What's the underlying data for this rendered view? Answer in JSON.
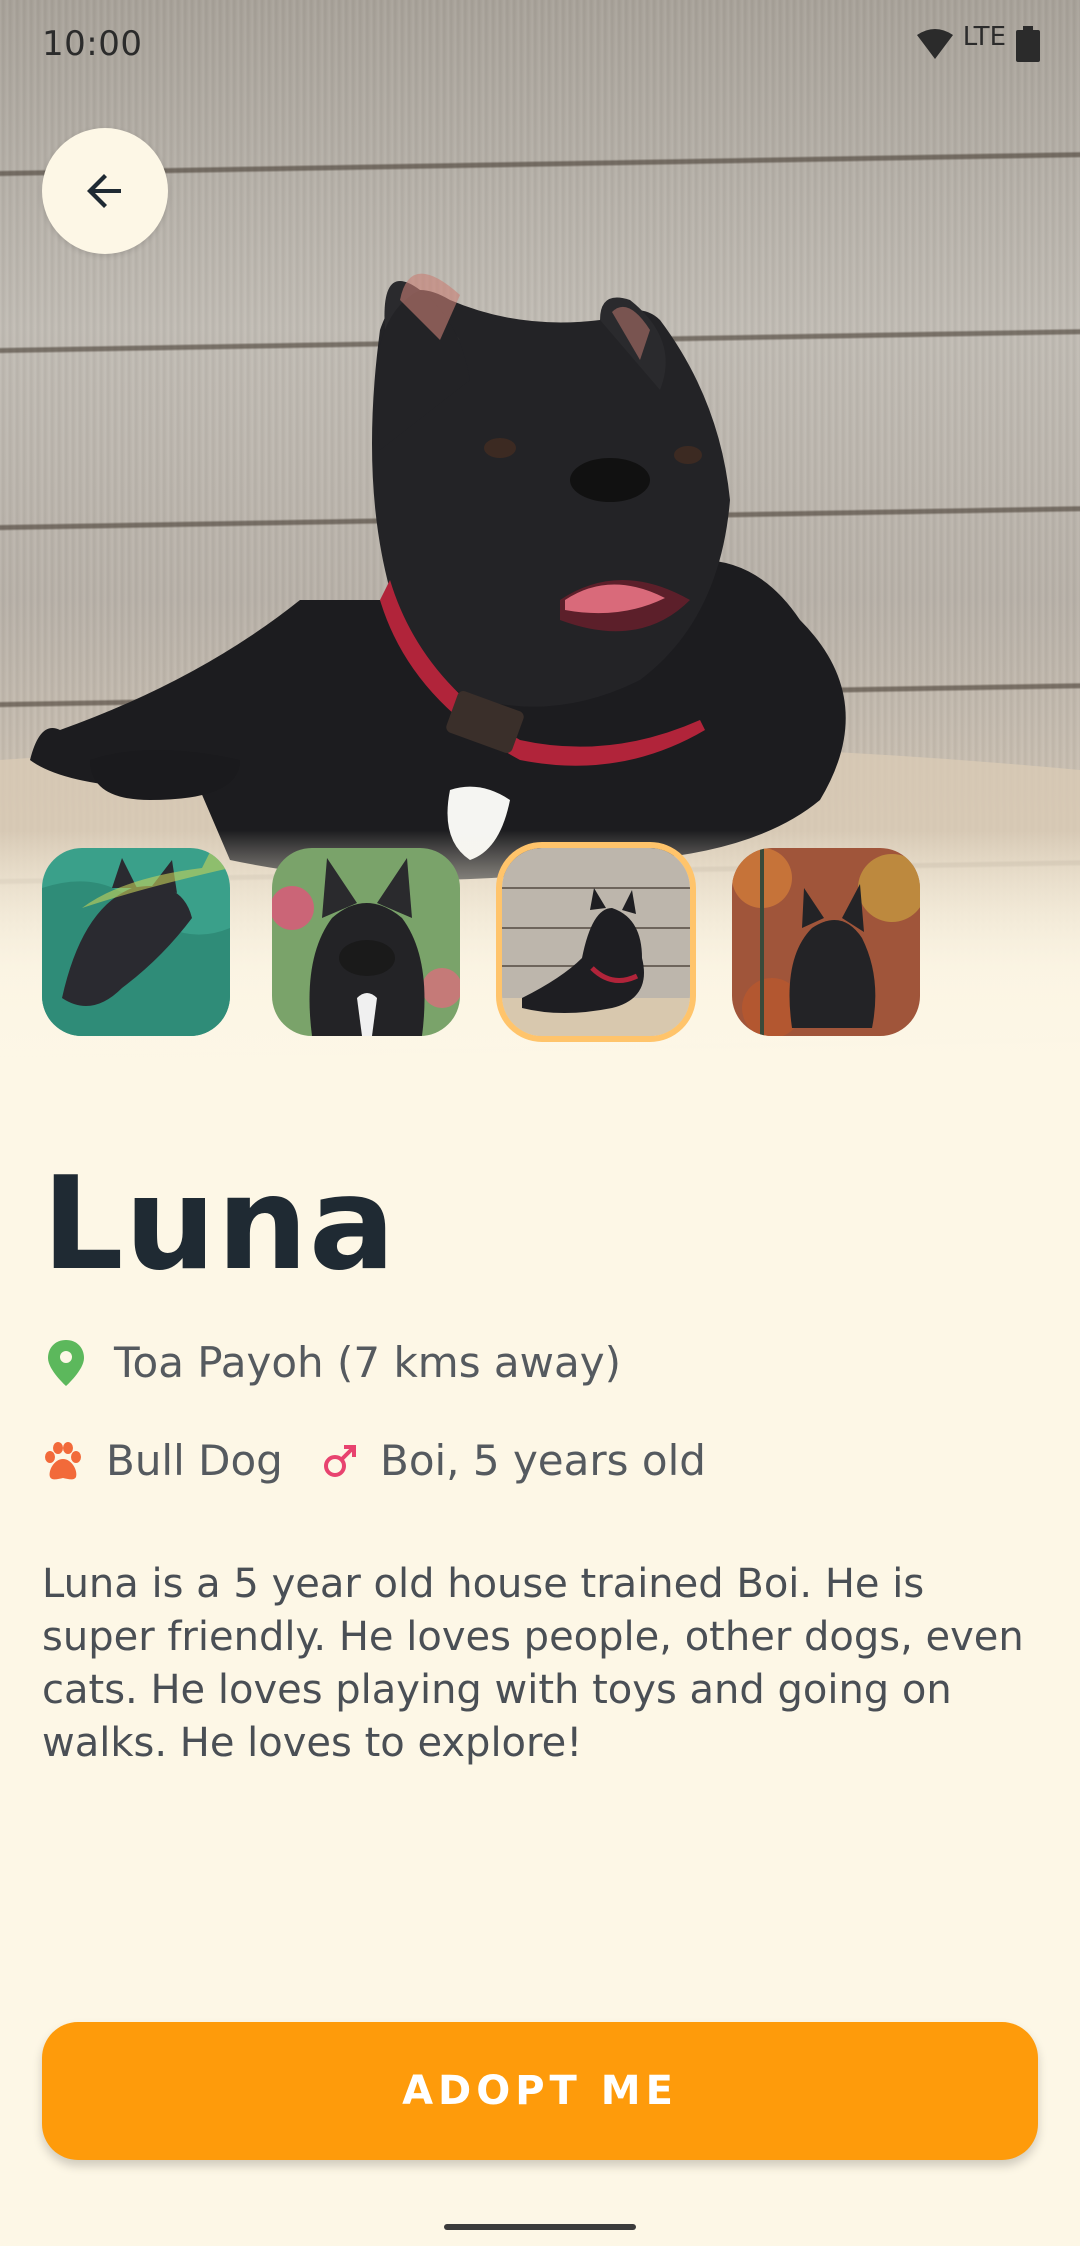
{
  "status_bar": {
    "time": "10:00",
    "network": "LTE",
    "icons": [
      "wifi-icon",
      "signal-icon",
      "battery-icon"
    ]
  },
  "header": {
    "back_icon": "arrow-back-icon"
  },
  "gallery": {
    "thumbnails": [
      {
        "name": "photo-1",
        "selected": false
      },
      {
        "name": "photo-2",
        "selected": false
      },
      {
        "name": "photo-3",
        "selected": true
      },
      {
        "name": "photo-4",
        "selected": false
      }
    ]
  },
  "pet": {
    "name": "Luna",
    "location": "Toa Payoh (7 kms away)",
    "breed": "Bull Dog",
    "gender_age": "Boi, 5 years old",
    "description": "Luna is a 5 year old house trained Boi. He is super friendly. He loves people, other dogs, even cats. He loves playing with toys and going on walks. He loves to explore!"
  },
  "actions": {
    "adopt_label": "ADOPT ME"
  },
  "colors": {
    "background": "#fdf7e6",
    "accent": "#fe9b0b",
    "selected_outline": "#ffc46b",
    "location_icon": "#5cb85c",
    "paw_icon": "#f26a3a",
    "gender_icon": "#e8436f"
  }
}
